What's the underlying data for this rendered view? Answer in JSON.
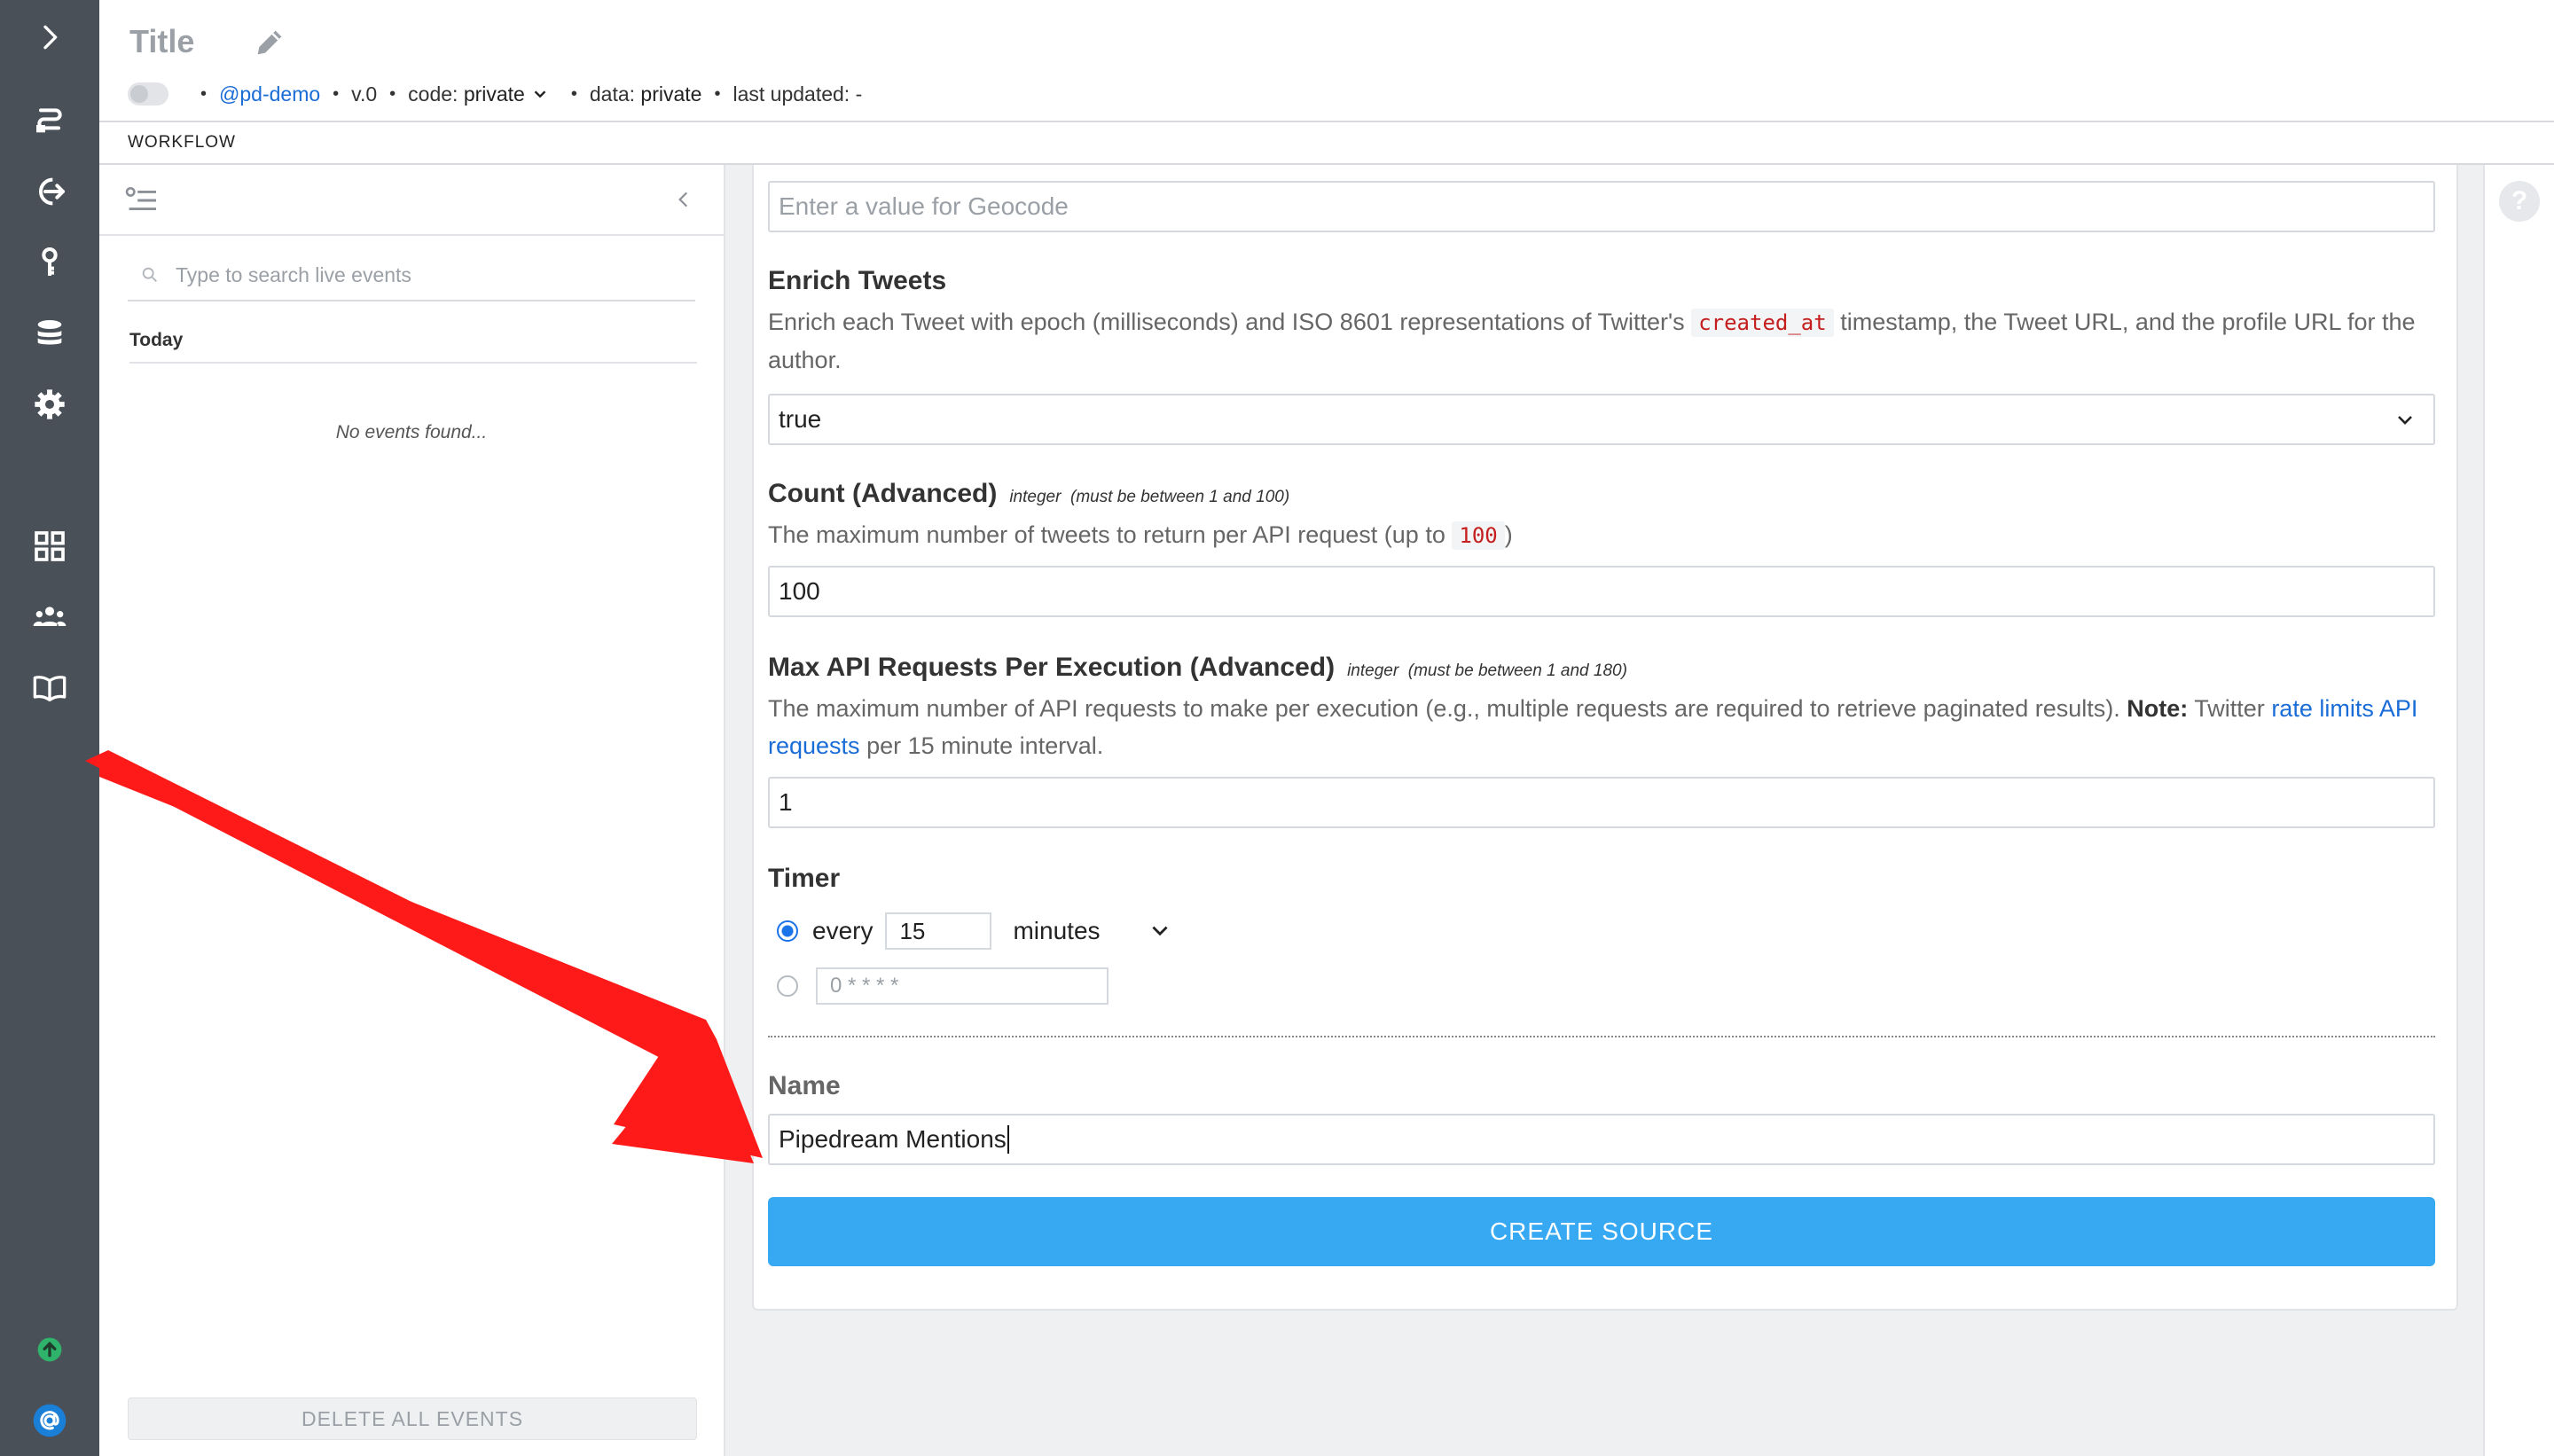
{
  "header": {
    "title": "Title",
    "owner": "@pd-demo",
    "version": "v.0",
    "code_label": "code:",
    "code_value": "private",
    "data_label": "data:",
    "data_value": "private",
    "updated_label": "last updated:",
    "updated_value": "-",
    "dot": "•"
  },
  "subheader": {
    "tab": "WORKFLOW"
  },
  "events": {
    "search_placeholder": "Type to search live events",
    "group": "Today",
    "empty": "No events found...",
    "delete_label": "DELETE ALL EVENTS"
  },
  "form": {
    "geocode_placeholder": "Enter a value for Geocode",
    "enrich": {
      "label": "Enrich Tweets",
      "desc_before": "Enrich each Tweet with epoch (milliseconds) and ISO 8601 representations of Twitter's",
      "code": "created_at",
      "desc_after": "timestamp, the Tweet URL, and the profile URL for the author.",
      "value": "true"
    },
    "count": {
      "label": "Count (Advanced)",
      "type": "integer",
      "range": "(must be between 1 and 100)",
      "desc_before": "The maximum number of tweets to return per API request (up to",
      "code": "100",
      "desc_after": ")",
      "value": "100"
    },
    "max_requests": {
      "label": "Max API Requests Per Execution (Advanced)",
      "type": "integer",
      "range": "(must be between 1 and 180)",
      "desc_before": "The maximum number of API requests to make per execution (e.g., multiple requests are required to retrieve paginated results).",
      "note": "Note:",
      "desc_mid": "Twitter",
      "link": "rate limits API requests",
      "desc_after": "per 15 minute interval.",
      "value": "1"
    },
    "timer": {
      "label": "Timer",
      "every": "every",
      "interval": "15",
      "unit": "minutes",
      "cron_placeholder": "0 * * * *"
    },
    "name": {
      "label": "Name",
      "value": "Pipedream Mentions"
    },
    "create_label": "CREATE SOURCE"
  },
  "help": {
    "glyph": "?"
  },
  "colors": {
    "rail": "#4a5058",
    "accent": "#36a9f2",
    "link": "#1a6cd6",
    "code": "#c41e1e",
    "arrow": "#ff1a1a",
    "status_green": "#2fb36b",
    "avatar_blue": "#1a7fd6"
  },
  "icons": {
    "rail": [
      "chevron-right-icon",
      "workflows-icon",
      "sources-icon",
      "key-icon",
      "database-icon",
      "settings-icon",
      "apps-grid-icon",
      "team-icon",
      "docs-book-icon",
      "status-up-icon",
      "at-sign-avatar-icon"
    ]
  }
}
